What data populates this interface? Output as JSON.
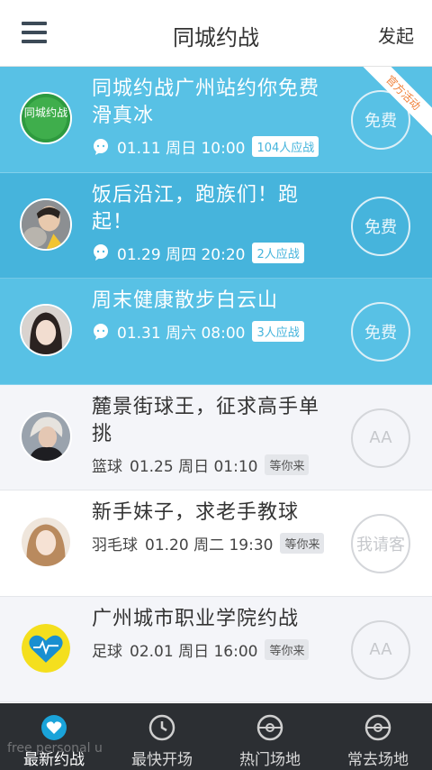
{
  "header": {
    "title": "同城约战",
    "action_label": "发起"
  },
  "items": [
    {
      "title": "同城约战广州站约你免费滑真冰",
      "sport": "",
      "time": "01.11 周日 10:00",
      "badge": "104人应战",
      "action": "免费",
      "ribbon": "官方活动",
      "avatar_text": "同城约战"
    },
    {
      "title": "饭后沿江，跑族们！跑起！",
      "sport": "",
      "time": "01.29 周四 20:20",
      "badge": "2人应战",
      "action": "免费"
    },
    {
      "title": "周末健康散步白云山",
      "sport": "",
      "time": "01.31 周六 08:00",
      "badge": "3人应战",
      "action": "免费"
    },
    {
      "title": "麓景街球王，征求高手单挑",
      "sport": "篮球",
      "time": "01.25 周日 01:10",
      "badge": "等你来",
      "action": "AA"
    },
    {
      "title": "新手妹子，求老手教球",
      "sport": "羽毛球",
      "time": "01.20 周二 19:30",
      "badge": "等你来",
      "action": "我请客"
    },
    {
      "title": "广州城市职业学院约战",
      "sport": "足球",
      "time": "02.01 周日 16:00",
      "badge": "等你来",
      "action": "AA"
    }
  ],
  "tabs": [
    {
      "label": "最新约战",
      "icon": "heart-icon",
      "active": true
    },
    {
      "label": "最快开场",
      "icon": "clock-icon",
      "active": false
    },
    {
      "label": "热门场地",
      "icon": "field-icon",
      "active": false
    },
    {
      "label": "常去场地",
      "icon": "field-icon",
      "active": false
    }
  ],
  "watermark": "free personal u",
  "colors": {
    "accent_blue": "#58c1e5",
    "tabbar": "#2c2f33",
    "ribbon_text": "#f0823c"
  }
}
